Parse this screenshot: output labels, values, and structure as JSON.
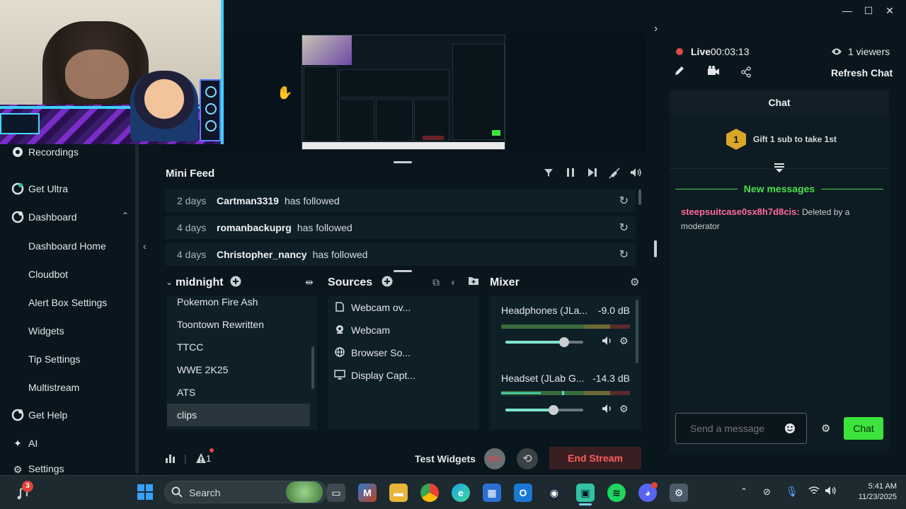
{
  "window": {
    "minimize": "—",
    "maximize": "☐",
    "close": "✕"
  },
  "sidebar": {
    "recordings": "Recordings",
    "get_ultra": "Get Ultra",
    "dashboard": "Dashboard",
    "dashboard_sub": [
      "Dashboard Home",
      "Cloudbot",
      "Alert Box Settings",
      "Widgets",
      "Tip Settings",
      "Multistream"
    ],
    "get_help": "Get Help",
    "ai": "AI",
    "settings": "Settings"
  },
  "mini_feed": {
    "title": "Mini Feed",
    "rows": [
      {
        "when": "2 days",
        "who": "Cartman3319",
        "action": "has followed"
      },
      {
        "when": "4 days",
        "who": "romanbackuprg",
        "action": "has followed"
      },
      {
        "when": "4 days",
        "who": "Christopher_nancy",
        "action": "has followed"
      }
    ]
  },
  "scenes": {
    "title": "midnight",
    "items": [
      "Pokemon Fire Ash",
      "Toontown Rewritten",
      "TTCC",
      "WWE 2K25",
      "ATS",
      "clips"
    ],
    "active_index": 5
  },
  "sources": {
    "title": "Sources",
    "items": [
      {
        "label": "Webcam ov...",
        "icon": "file-icon"
      },
      {
        "label": "Webcam",
        "icon": "webcam-icon"
      },
      {
        "label": "Browser So...",
        "icon": "globe-icon"
      },
      {
        "label": "Display Capt...",
        "icon": "monitor-icon"
      }
    ]
  },
  "mixer": {
    "title": "Mixer",
    "channels": [
      {
        "name": "Headphones (JLa...",
        "db": "-9.0 dB",
        "volume": 0.75
      },
      {
        "name": "Headset (JLab G...",
        "db": "-14.3 dB",
        "volume": 0.62
      }
    ]
  },
  "footer": {
    "alerts_count": "1",
    "test_widgets": "Test Widgets",
    "rec": "REC",
    "end_stream": "End Stream"
  },
  "chat": {
    "live_label": "Live",
    "live_time": "00:03:13",
    "viewers": "1 viewers",
    "refresh": "Refresh Chat",
    "header": "Chat",
    "gift_badge": "1",
    "gift_text": "Gift 1 sub to take 1st",
    "new_messages": "New messages",
    "message_user": "steepsuitcase0sx8h7d8cis:",
    "message_text": "Deleted by a moderator",
    "input_placeholder": "Send a message",
    "send_label": "Chat"
  },
  "taskbar": {
    "notif_badge": "3",
    "search_label": "Search",
    "time": "5:41 AM",
    "date": "11/23/2025"
  }
}
